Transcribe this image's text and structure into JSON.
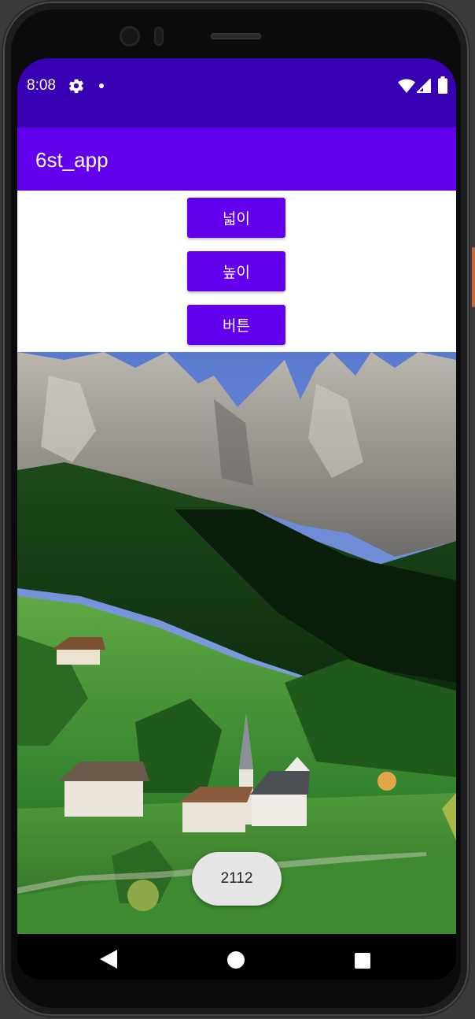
{
  "status_bar": {
    "time": "8:08",
    "icons": [
      "gear-icon",
      "notification-dot",
      "wifi-icon",
      "signal-icon",
      "battery-icon"
    ]
  },
  "app_bar": {
    "title": "6st_app",
    "color": "#6200ee",
    "status_color": "#3700b3"
  },
  "buttons": {
    "width_label": "넓이",
    "height_label": "높이",
    "button_label": "버튼"
  },
  "image": {
    "icon": "landscape-photo"
  },
  "toast": {
    "text": "2112"
  },
  "nav_bar": {
    "icons": [
      "back-icon",
      "home-icon",
      "recents-icon"
    ]
  }
}
